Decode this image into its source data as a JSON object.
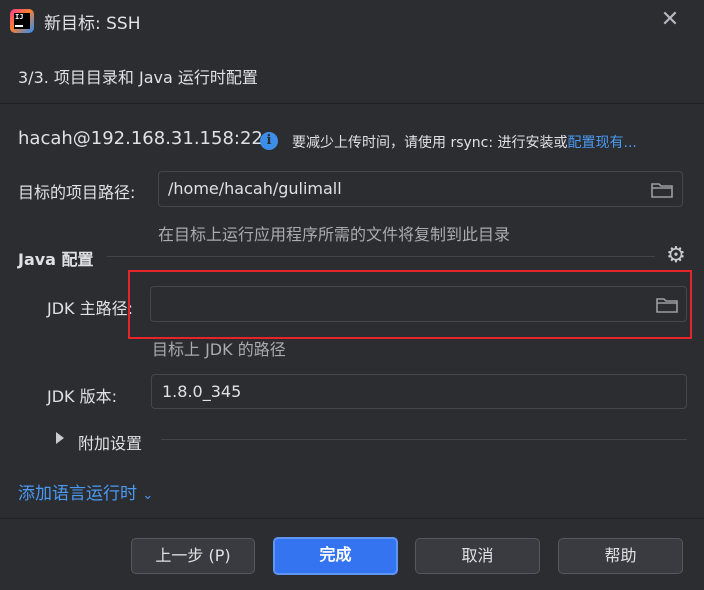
{
  "window": {
    "title": "新目标: SSH",
    "icon": "intellij-idea-icon",
    "icon_text": "IJ"
  },
  "step": {
    "title": "3/3. 项目目录和 Java 运行时配置"
  },
  "connection": {
    "host": "hacah@192.168.31.158:22",
    "hint_text": "要减少上传时间，请使用 rsync: 进行安装或",
    "hint_link": "配置现有..."
  },
  "project_path": {
    "label": "目标的项目路径:",
    "value": "/home/hacah/gulimall",
    "description": "在目标上运行应用程序所需的文件将复制到此目录"
  },
  "java_config": {
    "section_title": "Java 配置",
    "jdk_home_label": "JDK 主路径:",
    "jdk_home_value": "",
    "jdk_home_description": "目标上 JDK 的路径",
    "jdk_version_label": "JDK 版本:",
    "jdk_version_value": "1.8.0_345",
    "additional_settings": "附加设置"
  },
  "add_runtime_link": "添加语言运行时",
  "buttons": {
    "previous": "上一步 (P)",
    "finish": "完成",
    "cancel": "取消",
    "help": "帮助"
  },
  "colors": {
    "background": "#2b2d30",
    "accent": "#3574f0",
    "link": "#4a9af5",
    "highlight_box": "#e5242c"
  }
}
